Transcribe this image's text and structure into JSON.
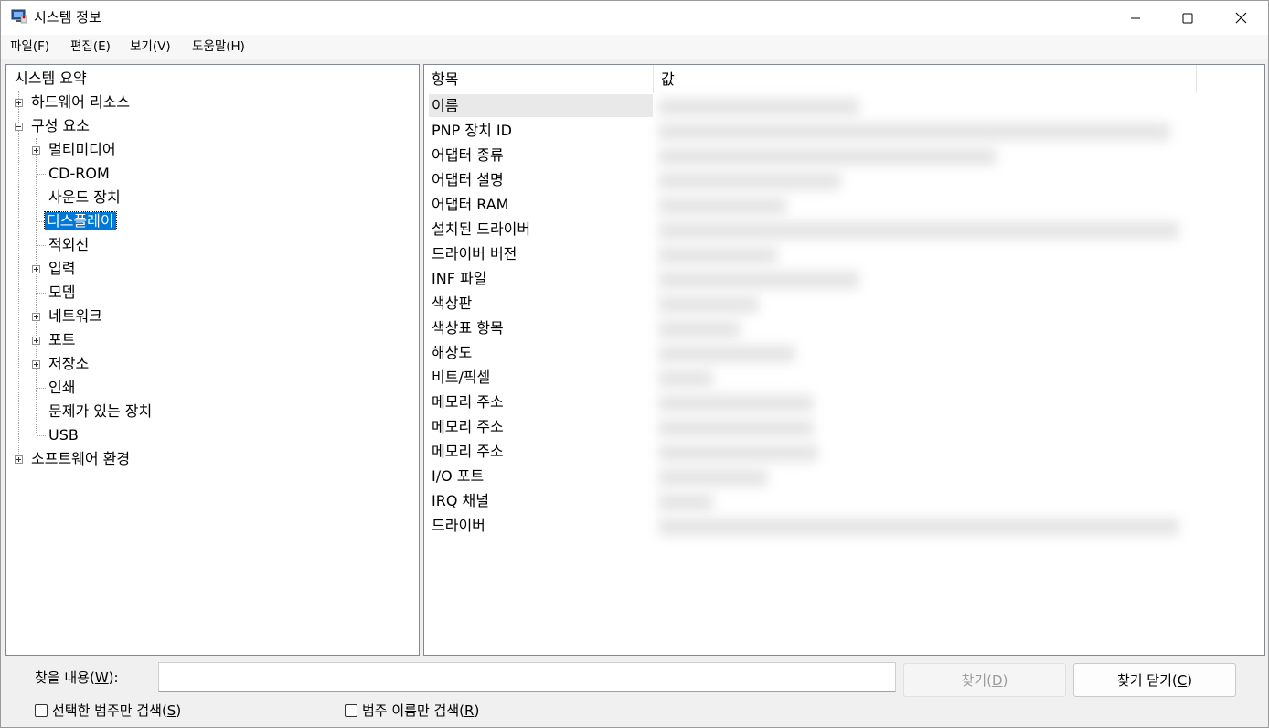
{
  "window": {
    "title": "시스템 정보"
  },
  "menu": [
    "파일(F)",
    "편집(E)",
    "보기(V)",
    "도움말(H)"
  ],
  "tree": [
    {
      "label": "시스템 요약",
      "level": 0,
      "expander": "none"
    },
    {
      "label": "하드웨어 리소스",
      "level": 0,
      "expander": "plus"
    },
    {
      "label": "구성 요소",
      "level": 0,
      "expander": "minus"
    },
    {
      "label": "멀티미디어",
      "level": 1,
      "expander": "plus"
    },
    {
      "label": "CD-ROM",
      "level": 1,
      "expander": "none"
    },
    {
      "label": "사운드 장치",
      "level": 1,
      "expander": "none"
    },
    {
      "label": "디스플레이",
      "level": 1,
      "expander": "none",
      "selected": true
    },
    {
      "label": "적외선",
      "level": 1,
      "expander": "none"
    },
    {
      "label": "입력",
      "level": 1,
      "expander": "plus"
    },
    {
      "label": "모뎀",
      "level": 1,
      "expander": "none"
    },
    {
      "label": "네트워크",
      "level": 1,
      "expander": "plus"
    },
    {
      "label": "포트",
      "level": 1,
      "expander": "plus"
    },
    {
      "label": "저장소",
      "level": 1,
      "expander": "plus"
    },
    {
      "label": "인쇄",
      "level": 1,
      "expander": "none"
    },
    {
      "label": "문제가 있는 장치",
      "level": 1,
      "expander": "none"
    },
    {
      "label": "USB",
      "level": 1,
      "expander": "none"
    },
    {
      "label": "소프트웨어 환경",
      "level": 0,
      "expander": "plus"
    }
  ],
  "list": {
    "columns": [
      "항목",
      "값"
    ],
    "items": [
      "이름",
      "PNP 장치 ID",
      "어댑터 종류",
      "어댑터 설명",
      "어댑터 RAM",
      "설치된 드라이버",
      "드라이버 버전",
      "INF 파일",
      "색상판",
      "색상표 항목",
      "해상도",
      "비트/픽셀",
      "메모리 주소",
      "메모리 주소",
      "메모리 주소",
      "I/O 포트",
      "IRQ 채널",
      "드라이버"
    ]
  },
  "search": {
    "label": "찾을 내용",
    "label_key": "W",
    "value": "",
    "find_button": "찾기",
    "find_key": "D",
    "close_button": "찾기 닫기",
    "close_key": "C",
    "check_selected": "선택한 범주만 검색",
    "check_selected_key": "S",
    "check_names": "범주 이름만 검색",
    "check_names_key": "R"
  }
}
